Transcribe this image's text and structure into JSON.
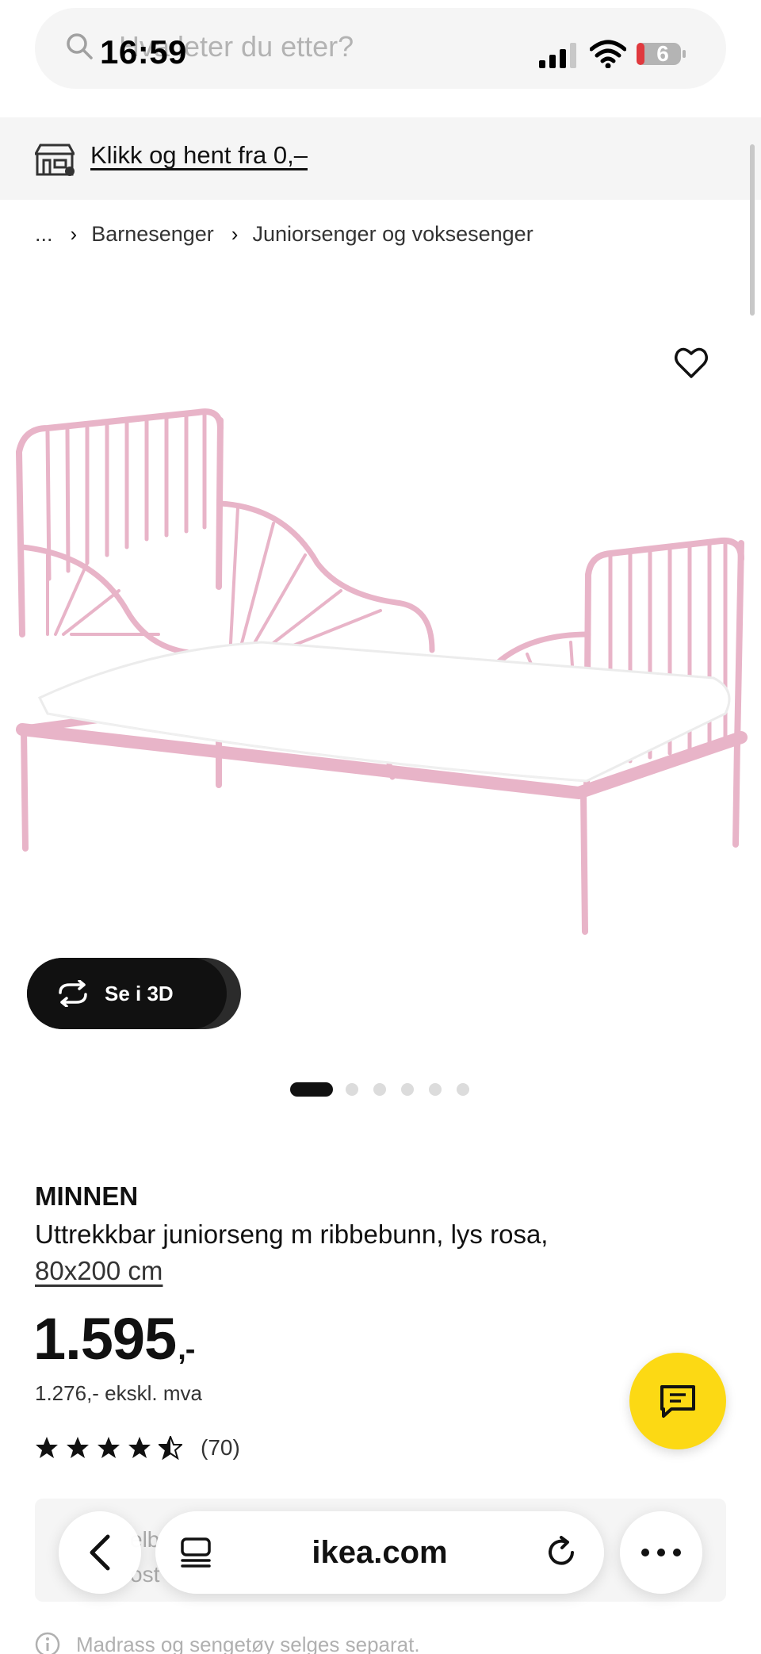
{
  "status_bar": {
    "time": "16:59",
    "battery_level": "6"
  },
  "search": {
    "placeholder": "Hva leter du etter?"
  },
  "store_banner": {
    "label": "Klikk og hent fra 0,–"
  },
  "breadcrumbs": [
    "...",
    "Barnesenger",
    "Juniorsenger og voksesenger"
  ],
  "gallery": {
    "view_3d_label": "Se i 3D",
    "slide_count": 6,
    "active_slide": 1
  },
  "product": {
    "brand": "MINNEN",
    "description": "Uttrekkbar juniorseng m ribbebunn, lys rosa,",
    "size": "80x200 cm",
    "price": "1.595",
    "price_suffix": ",-",
    "price_ex_vat": "1.276,- ekskl. mva",
    "rating_value": 4.5,
    "rating_count": "(70)"
  },
  "card_peek": {
    "line1": "elb",
    "line2": "ost"
  },
  "note": {
    "text": "Madrass og sengetøy selges separat."
  },
  "browser": {
    "url": "ikea.com"
  },
  "colors": {
    "accent_yellow": "#fcd914",
    "bed_pink": "#e8b4c8"
  }
}
